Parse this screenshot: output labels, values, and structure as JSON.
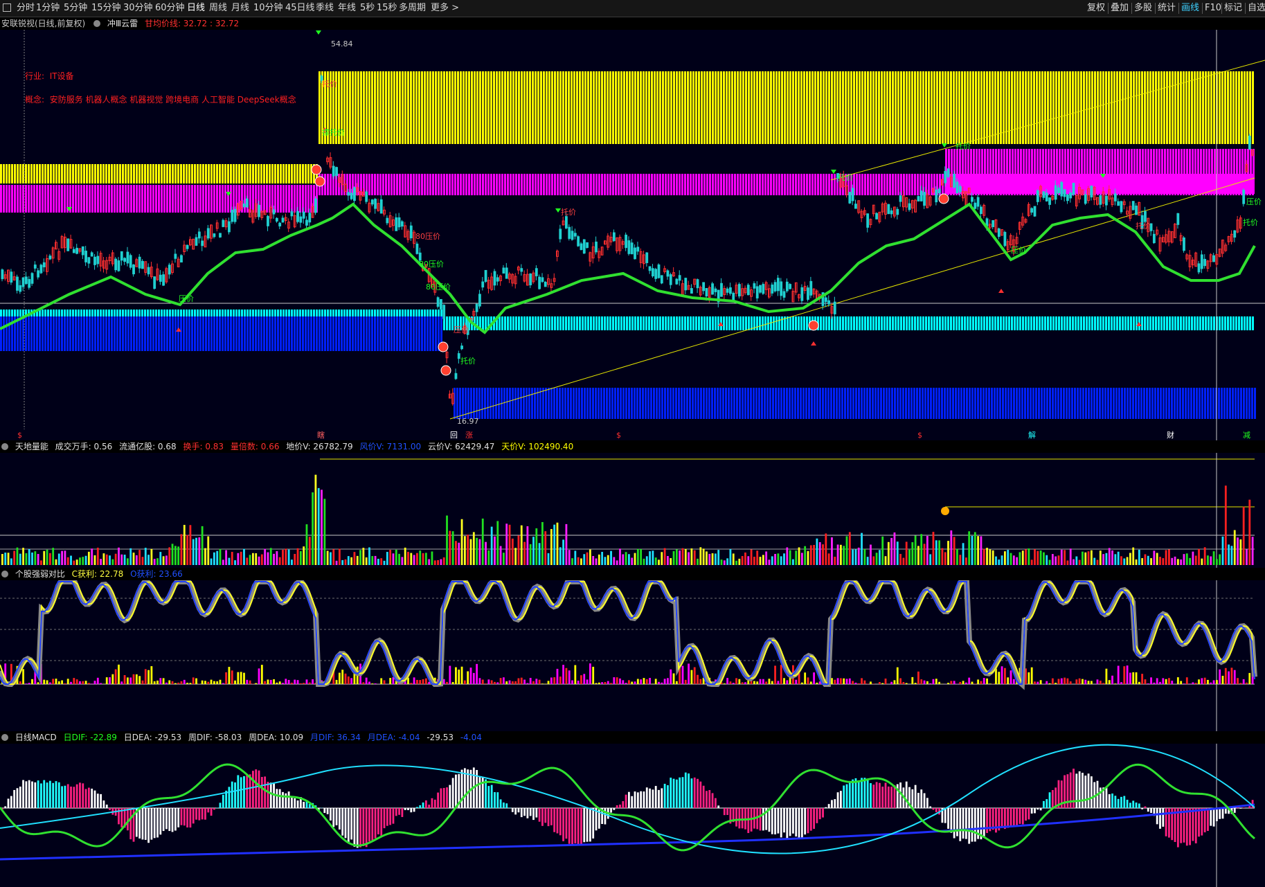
{
  "toolbar": {
    "periods": [
      "分时",
      "1分钟",
      "5分钟",
      "15分钟",
      "30分钟",
      "60分钟",
      "日线",
      "周线",
      "月线",
      "10分钟",
      "45日线",
      "季线",
      "年线",
      "5秒",
      "15秒",
      "多周期",
      "更多 >"
    ],
    "active_period": "日线",
    "right_buttons": [
      "复权",
      "叠加",
      "多股",
      "统计",
      "画线",
      "F10",
      "标记",
      "自选"
    ],
    "active_right": "画线"
  },
  "main_pane": {
    "stock_name": "安联锐视(日线,前复权)",
    "indicator": "冲Ⅲ云雷",
    "avg_label": "甘均价线: 32.72 : 32.72",
    "industry_label": "行业:",
    "industry_value": "IT设备",
    "concept_label": "概念:",
    "concept_value": "安防服务 机器人概念 机器视觉 跨境电商 人工智能 DeepSeek概念",
    "high_price": "54.84",
    "low_price": "16.97",
    "price_labels": [
      "托价",
      "撑托价",
      "压价",
      "80压价",
      "80压价",
      "80压价",
      "压价",
      "托价",
      "托价",
      "托价",
      "压价",
      "托价",
      "托价",
      "压价",
      "托价"
    ],
    "bottom_markers": [
      "$",
      "瞎",
      "回",
      "涨",
      "$",
      "$",
      "解",
      "财",
      "减"
    ]
  },
  "volume_pane": {
    "name": "天地量能",
    "vol_label": "成交万手: 0.56",
    "flow_label": "流通亿股: 0.68",
    "turnover_label": "换手: 0.83",
    "ratio_label": "量倍数: 0.66",
    "ground_label": "地价V: 26782.79",
    "wind_label": "风价V: 7131.00",
    "cloud_label": "云价V: 62429.47",
    "sky_label": "天价V: 102490.40"
  },
  "strength_pane": {
    "name": "个股强弱对比",
    "c_label": "C获利: 22.78",
    "o_label": "O获利: 23.66"
  },
  "macd_pane": {
    "name": "日线MACD",
    "dif": "日DIF: -22.89",
    "dea": "日DEA: -29.53",
    "week_dif": "周DIF: -58.03",
    "week_dea": "周DEA: 10.09",
    "month_dif": "月DIF: 36.34",
    "month_dea": "月DEA: -4.04",
    "v1": "-29.53",
    "v2": "-4.04"
  },
  "colors": {
    "yellow": "#ffff00",
    "magenta": "#ff00ff",
    "cyan": "#00ffff",
    "blue": "#0020ff",
    "green": "#20ff20",
    "red": "#ff2020",
    "gray": "#909090"
  }
}
